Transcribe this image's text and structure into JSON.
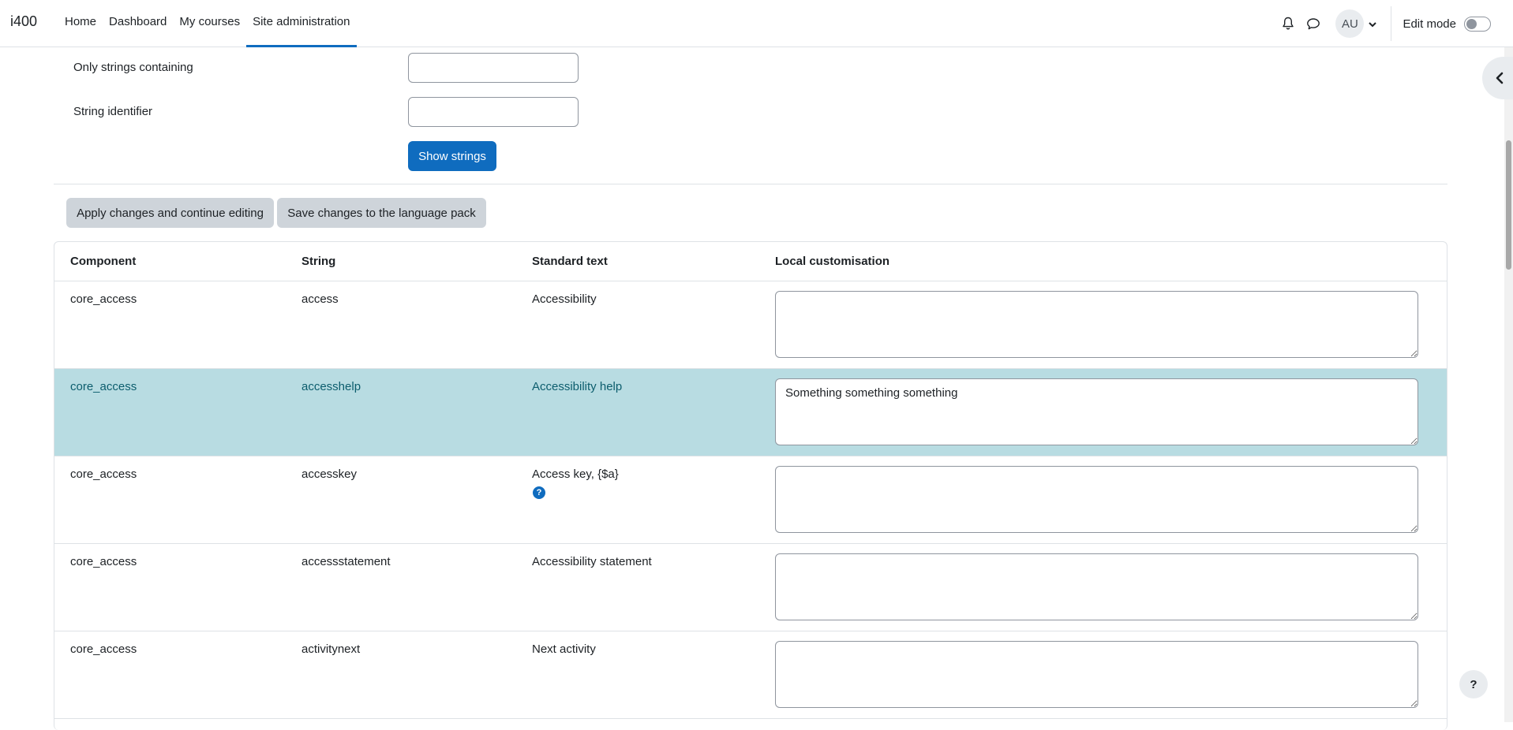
{
  "navbar": {
    "brand": "i400",
    "links": [
      "Home",
      "Dashboard",
      "My courses",
      "Site administration"
    ],
    "active_link": "Site administration",
    "avatar_initials": "AU",
    "edit_mode_label": "Edit mode",
    "edit_mode_on": false
  },
  "filters": {
    "only_strings_label": "Only strings containing",
    "only_strings_value": "",
    "string_identifier_label": "String identifier",
    "string_identifier_value": "",
    "show_strings_button": "Show strings"
  },
  "actions": {
    "apply_button": "Apply changes and continue editing",
    "save_button": "Save changes to the language pack"
  },
  "table": {
    "headers": [
      "Component",
      "String",
      "Standard text",
      "Local customisation"
    ],
    "rows": [
      {
        "component": "core_access",
        "string": "access",
        "standard": "Accessibility",
        "local": ""
      },
      {
        "component": "core_access",
        "string": "accesshelp",
        "standard": "Accessibility help",
        "local": "Something something something"
      },
      {
        "component": "core_access",
        "string": "accesskey",
        "standard": "Access key, {$a}",
        "local": ""
      },
      {
        "component": "core_access",
        "string": "accessstatement",
        "standard": "Accessibility statement",
        "local": ""
      },
      {
        "component": "core_access",
        "string": "activitynext",
        "standard": "Next activity",
        "local": ""
      }
    ]
  },
  "help_fab": "?",
  "help_icon": "?",
  "colors": {
    "primary": "#0f6cbf",
    "highlight_row": "#b8dce2"
  }
}
